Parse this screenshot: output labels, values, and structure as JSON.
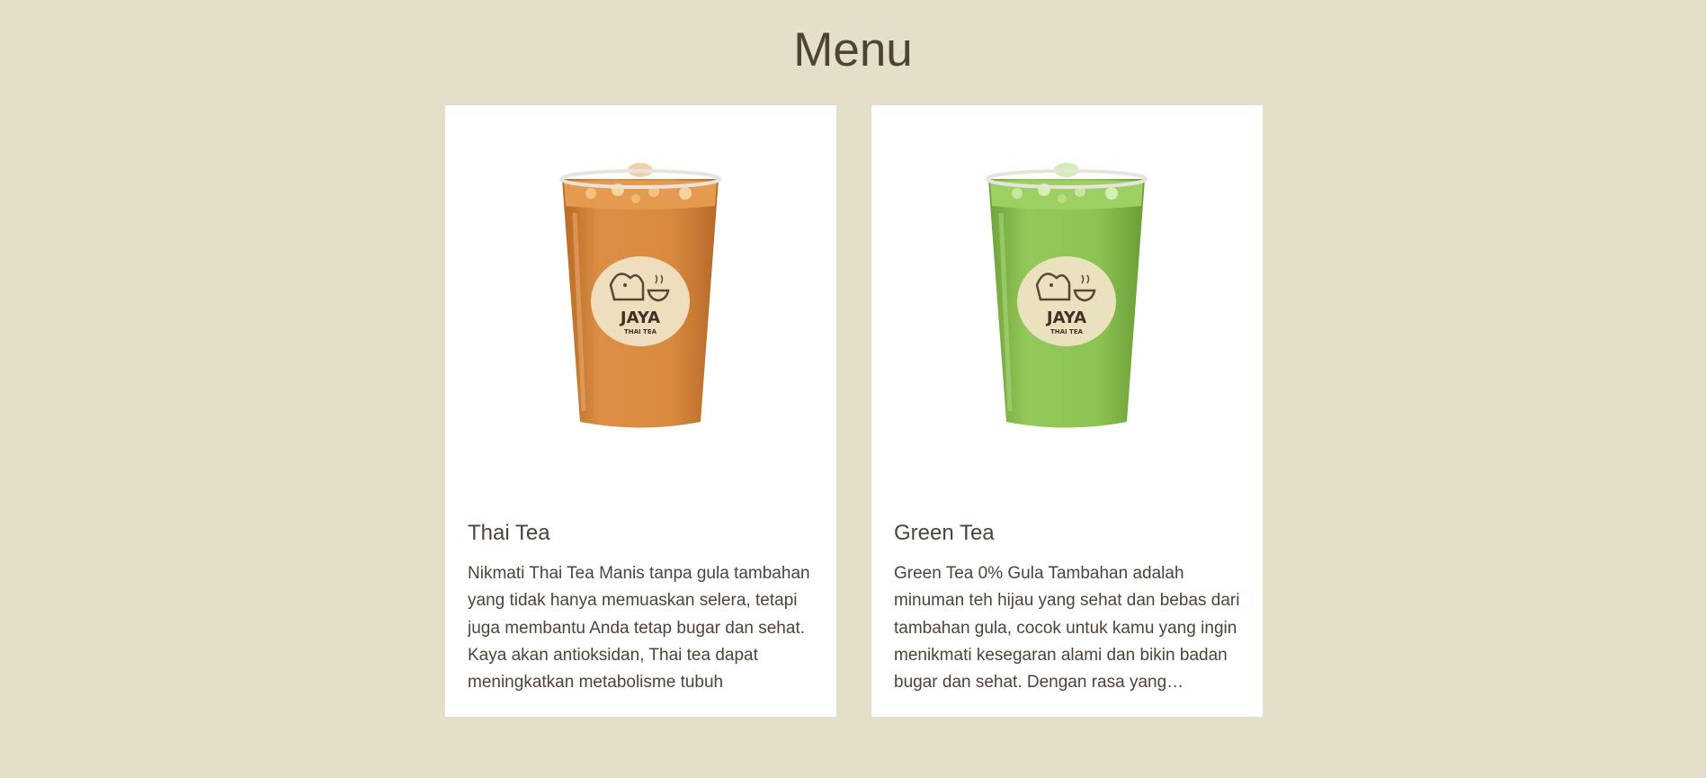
{
  "page": {
    "title": "Menu"
  },
  "colors": {
    "background": "#e4dfc8",
    "card": "#ffffff",
    "text": "#4f4338",
    "thai_tea": "#d98a3e",
    "green_tea": "#8cc452",
    "logo_badge": "#efe3c4"
  },
  "menu": {
    "items": [
      {
        "name": "Thai Tea",
        "image_icon": "thai-tea-cup-icon",
        "brand": "JAYA",
        "brand_sub": "THAI TEA",
        "description": "Nikmati Thai Tea Manis tanpa gula tambahan yang tidak hanya memuaskan selera, tetapi juga membantu Anda tetap bugar dan sehat. Kaya akan antioksidan, Thai tea dapat meningkatkan metabolisme tubuh"
      },
      {
        "name": "Green Tea",
        "image_icon": "green-tea-cup-icon",
        "brand": "JAYA",
        "brand_sub": "THAI TEA",
        "description": "Green Tea 0% Gula Tambahan adalah minuman teh hijau yang sehat dan bebas dari tambahan gula, cocok untuk kamu yang ingin menikmati kesegaran alami dan bikin badan bugar dan sehat. Dengan rasa yang menyegarkan"
      }
    ]
  }
}
